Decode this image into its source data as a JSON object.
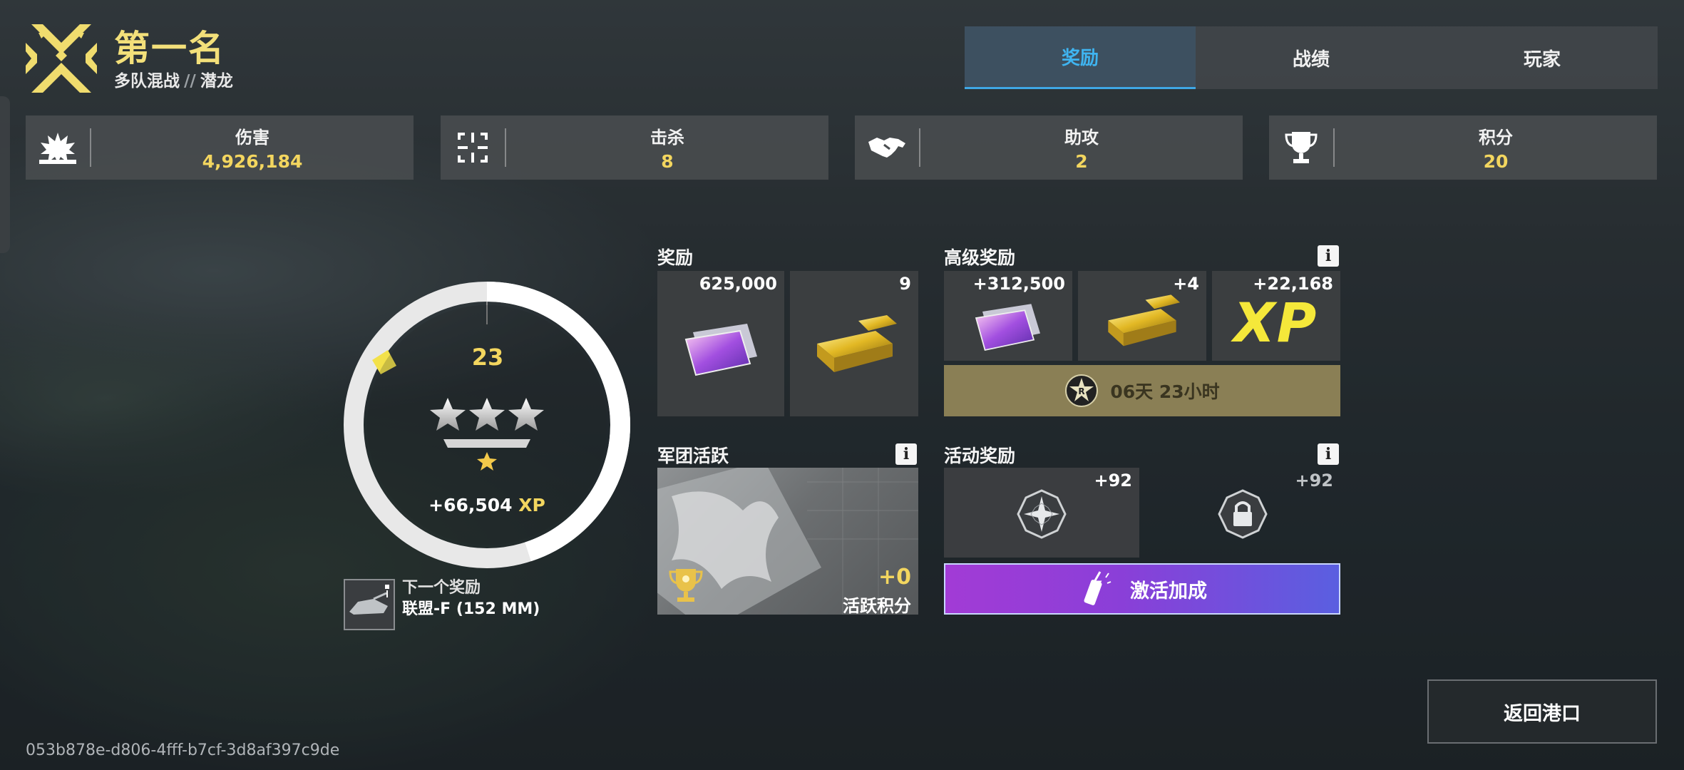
{
  "header": {
    "title": "第一名",
    "mode": "多队混战",
    "separator": "//",
    "map": "潜龙"
  },
  "tabs": [
    {
      "label": "奖励",
      "active": true
    },
    {
      "label": "战绩",
      "active": false
    },
    {
      "label": "玩家",
      "active": false
    }
  ],
  "stats": [
    {
      "label": "伤害",
      "value": "4,926,184",
      "icon": "explosion-icon"
    },
    {
      "label": "击杀",
      "value": "8",
      "icon": "crosshair-icon"
    },
    {
      "label": "助攻",
      "value": "2",
      "icon": "handshake-icon"
    },
    {
      "label": "积分",
      "value": "20",
      "icon": "trophy-icon"
    }
  ],
  "rank": {
    "level": "23",
    "xp_gain": "+66,504",
    "xp_unit": "XP",
    "stars": 3,
    "progress_fraction": 0.45
  },
  "next_reward": {
    "label": "下一个奖励",
    "value": "联盟-F (152 MM)"
  },
  "rewards": {
    "title": "奖励",
    "items": [
      {
        "amount": "625,000",
        "icon": "credits-icon"
      },
      {
        "amount": "9",
        "icon": "gold-bars-icon"
      }
    ]
  },
  "premium_rewards": {
    "title": "高级奖励",
    "items": [
      {
        "amount": "+312,500",
        "icon": "credits-icon"
      },
      {
        "amount": "+4",
        "icon": "gold-bars-icon"
      },
      {
        "amount": "+22,168",
        "icon": "xp-icon",
        "text": "XP"
      }
    ],
    "timer": "06天 23小时"
  },
  "legion": {
    "title": "军团活跃",
    "points": "+0",
    "points_label": "活跃积分"
  },
  "event_rewards": {
    "title": "活动奖励",
    "items": [
      {
        "amount": "+92",
        "icon": "compass-star-icon"
      },
      {
        "amount": "+92",
        "icon": "locked-icon"
      }
    ],
    "activate_label": "激活加成"
  },
  "return_button": "返回港口",
  "session_id": "053b878e-d806-4fff-b7cf-3d8af397c9de",
  "colors": {
    "accent_gold": "#f3d65f",
    "tab_active": "#3fb4f0",
    "activate_gradient_start": "#a23bd6",
    "activate_gradient_end": "#5a5fe0"
  }
}
